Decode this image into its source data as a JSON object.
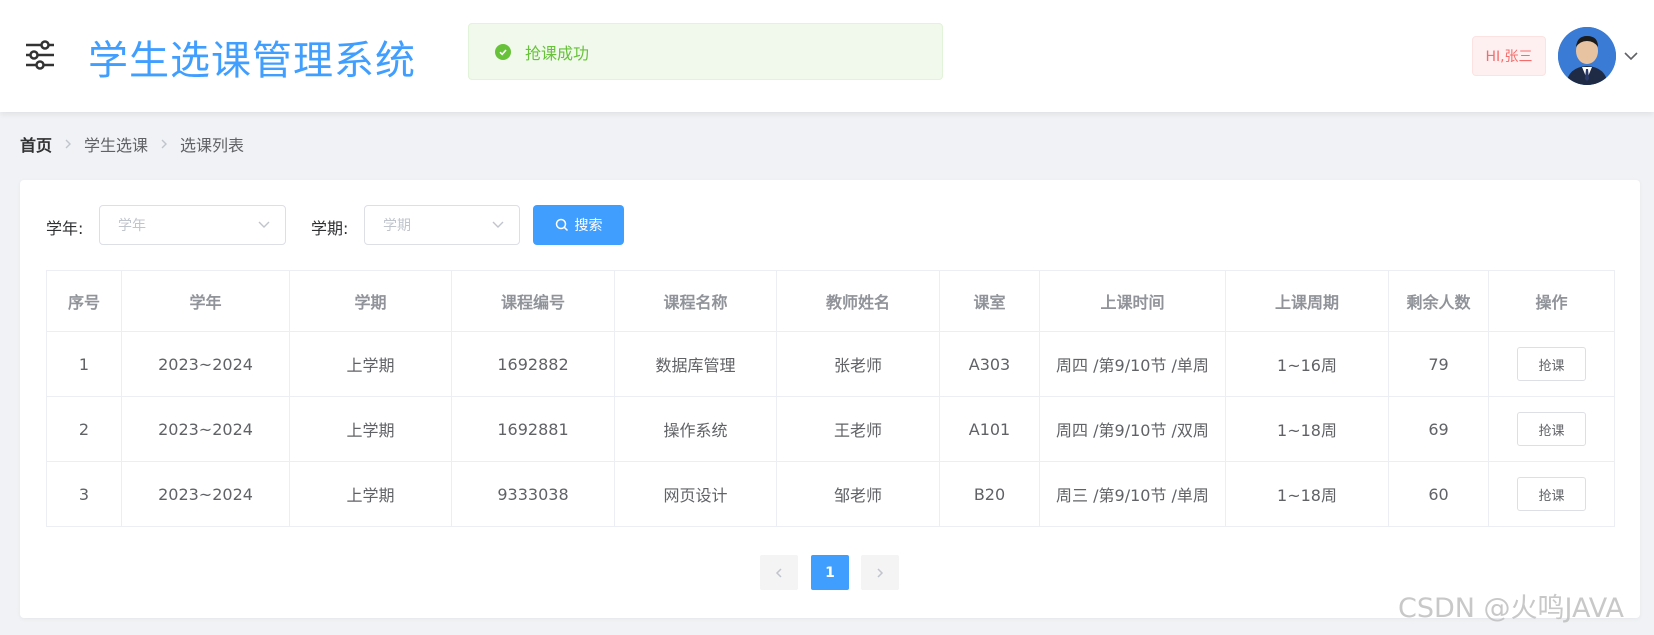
{
  "header": {
    "title": "学生选课管理系统",
    "greeting": "HI,张三"
  },
  "toast": {
    "message": "抢课成功"
  },
  "breadcrumb": {
    "items": [
      "首页",
      "学生选课",
      "选课列表"
    ]
  },
  "filters": {
    "year_label": "学年:",
    "year_placeholder": "学年",
    "term_label": "学期:",
    "term_placeholder": "学期",
    "search_label": "搜索"
  },
  "table": {
    "columns": [
      "序号",
      "学年",
      "学期",
      "课程编号",
      "课程名称",
      "教师姓名",
      "课室",
      "上课时间",
      "上课周期",
      "剩余人数",
      "操作"
    ],
    "rows": [
      [
        "1",
        "2023~2024",
        "上学期",
        "1692882",
        "数据库管理",
        "张老师",
        "A303",
        "周四 /第9/10节 /单周",
        "1~16周",
        "79",
        "抢课"
      ],
      [
        "2",
        "2023~2024",
        "上学期",
        "1692881",
        "操作系统",
        "王老师",
        "A101",
        "周四 /第9/10节 /双周",
        "1~18周",
        "69",
        "抢课"
      ],
      [
        "3",
        "2023~2024",
        "上学期",
        "9333038",
        "网页设计",
        "邹老师",
        "B20",
        "周三 /第9/10节 /单周",
        "1~18周",
        "60",
        "抢课"
      ]
    ]
  },
  "pagination": {
    "current": "1"
  },
  "watermark": "CSDN @火鸣JAVA",
  "colors": {
    "primary": "#409eff",
    "success": "#67c23a",
    "danger": "#f56c6c"
  },
  "icons": [
    "menu-icon",
    "check-circle-icon",
    "chevron-down-icon",
    "chevron-right-icon",
    "search-icon",
    "chevron-left-icon"
  ]
}
